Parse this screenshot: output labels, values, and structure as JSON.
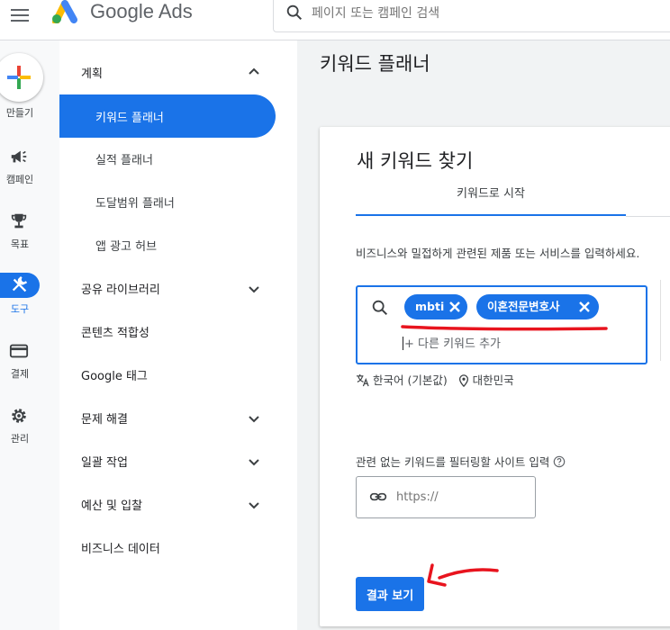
{
  "header": {
    "brand": "Google Ads",
    "search_placeholder": "페이지 또는 캠페인 검색"
  },
  "rail": {
    "create_label": "만들기",
    "items": [
      {
        "label": "캠페인",
        "icon": "megaphone-icon"
      },
      {
        "label": "목표",
        "icon": "trophy-icon"
      },
      {
        "label": "도구",
        "icon": "tools-icon",
        "active": true
      },
      {
        "label": "결제",
        "icon": "credit-card-icon"
      },
      {
        "label": "관리",
        "icon": "gear-icon"
      }
    ]
  },
  "sidenav": {
    "section_planning": "계획",
    "sub_items": [
      "키워드 플래너",
      "실적 플래너",
      "도달범위 플래너",
      "앱 광고 허브"
    ],
    "items": [
      "공유 라이브러리",
      "콘텐츠 적합성",
      "Google 태그",
      "문제 해결",
      "일괄 작업",
      "예산 및 입찰",
      "비즈니스 데이터"
    ]
  },
  "main": {
    "page_title": "키워드 플래너",
    "card": {
      "title": "새 키워드 찾기",
      "tab": "키워드로 시작",
      "description": "비즈니스와 밀접하게 관련된 제품 또는 서비스를 입력하세요.",
      "chips": [
        "mbti",
        "이혼전문변호사"
      ],
      "add_placeholder": "+ 다른 키워드 추가",
      "language": "한국어 (기본값)",
      "location": "대한민국",
      "filter_label": "관련 없는 키워드를 필터링할 사이트 입력",
      "url_placeholder": "https://",
      "results_button": "결과 보기"
    }
  },
  "colors": {
    "accent": "#1a73e8",
    "annotation_red": "#e8141e"
  }
}
